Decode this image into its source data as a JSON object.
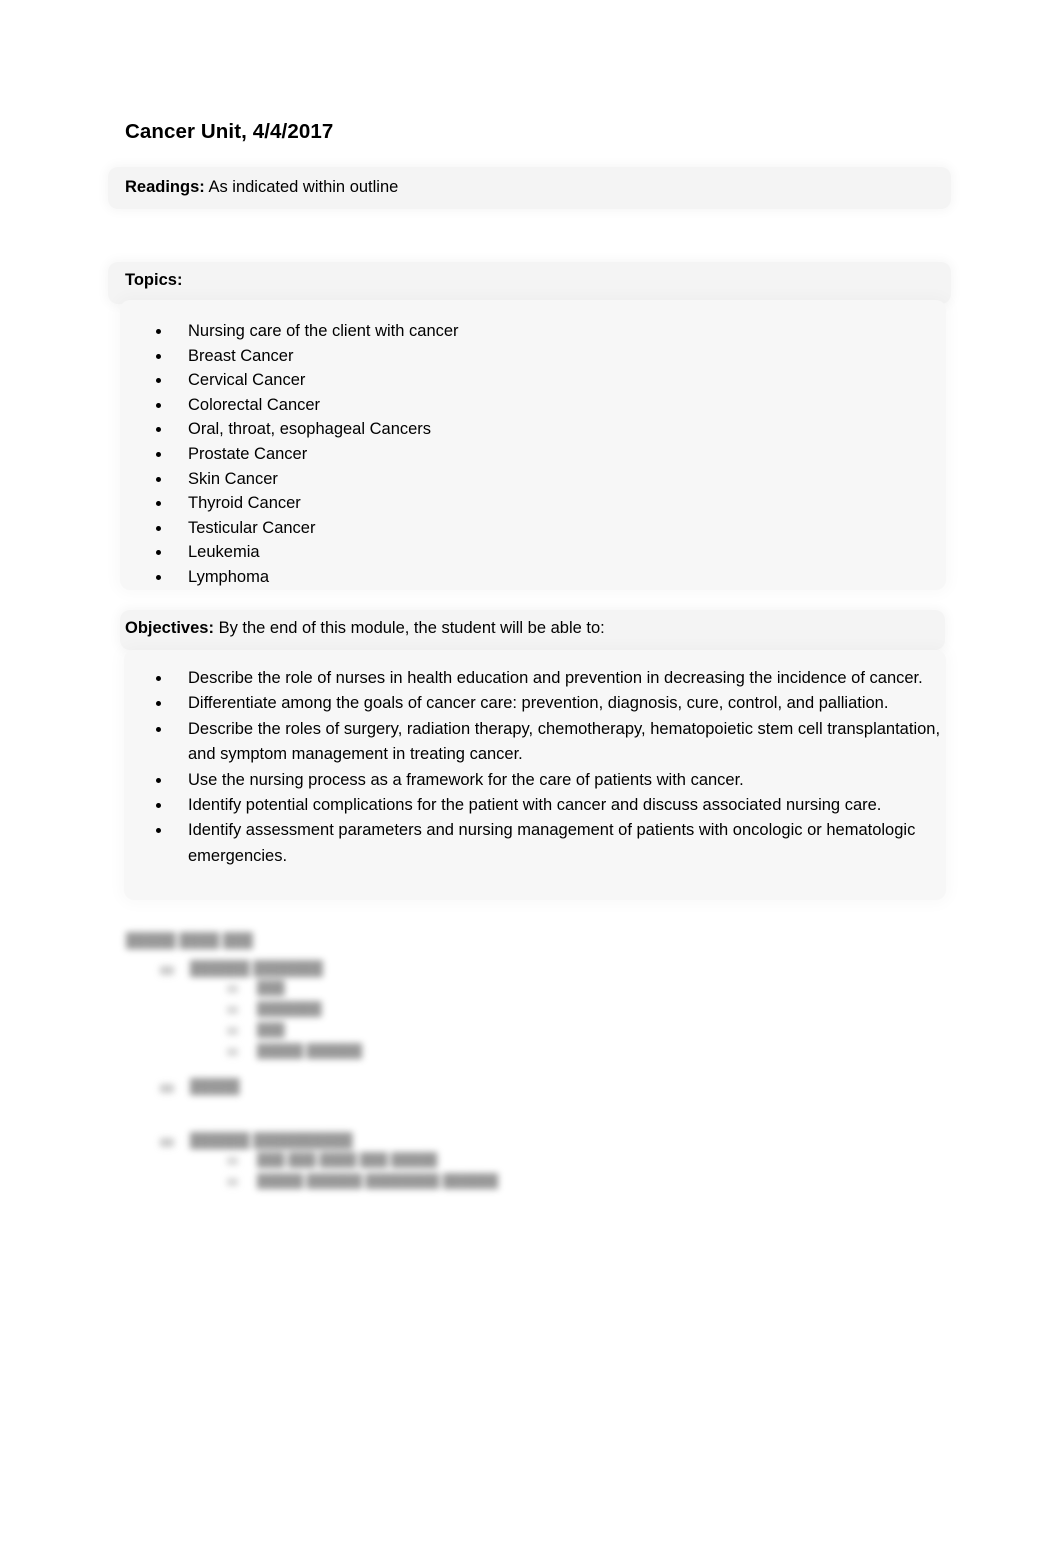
{
  "document": {
    "title": "Cancer Unit, 4/4/2017",
    "background_color": "#ffffff",
    "text_color": "#000000",
    "shade_color": "#f4f4f4"
  },
  "readings": {
    "label": "Readings:",
    "value": "As indicated within outline"
  },
  "topics": {
    "label": "Topics:",
    "value": "",
    "items": [
      "Nursing care of the client with cancer",
      "Breast Cancer",
      "Cervical Cancer",
      "Colorectal Cancer",
      "Oral, throat, esophageal Cancers",
      "Prostate Cancer",
      "Skin Cancer",
      "Thyroid Cancer",
      "Testicular Cancer",
      "Leukemia",
      "Lymphoma"
    ]
  },
  "objectives": {
    "label": "Objectives:",
    "value": "By the end of this module, the student will be able to:",
    "items": [
      "Describe the role of nurses in health education and prevention in decreasing the incidence of cancer.",
      "Differentiate among the goals of cancer care: prevention, diagnosis, cure, control, and palliation.",
      "Describe the roles of surgery, radiation therapy, chemotherapy, hematopoietic stem cell transplantation, and symptom management in treating cancer.",
      "Use the nursing process as a framework for the care of patients with cancer.",
      "Identify potential complications for the patient with cancer and discuss associated nursing care.",
      "Identify assessment parameters and nursing management of patients with oncologic or hematologic emergencies."
    ]
  },
  "obscured_outline": {
    "note": "illegible",
    "title": "",
    "entries": [
      {
        "level": 1,
        "text": ""
      },
      {
        "level": 2,
        "text": ""
      },
      {
        "level": 2,
        "text": ""
      },
      {
        "level": 2,
        "text": ""
      },
      {
        "level": 2,
        "text": ""
      },
      {
        "level": 1,
        "text": ""
      },
      {
        "level": 1,
        "text": ""
      },
      {
        "level": 2,
        "text": ""
      },
      {
        "level": 2,
        "text": ""
      }
    ]
  }
}
